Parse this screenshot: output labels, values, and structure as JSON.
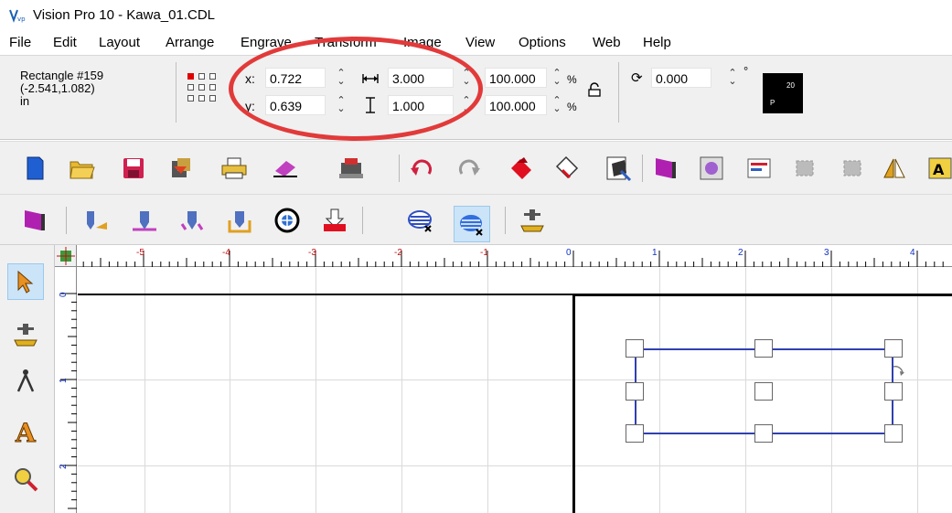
{
  "window": {
    "title": "Vision Pro 10 - Kawa_01.CDL"
  },
  "menu": [
    "File",
    "Edit",
    "Layout",
    "Arrange",
    "Engrave",
    "Transform",
    "Image",
    "View",
    "Options",
    "Web",
    "Help"
  ],
  "object_info": {
    "name": "Rectangle #159",
    "coords": "(-2.541,1.082)",
    "units": "in"
  },
  "properties": {
    "x_label": "x:",
    "x_value": "0.722",
    "y_label": "y:",
    "y_value": "0.639",
    "width_value": "3.000",
    "height_value": "1.000",
    "scale_x": "100.000",
    "scale_y": "100.000",
    "percent": "%",
    "rotation_value": "0.000",
    "degree": "°"
  },
  "font_swatch": {
    "size": "20",
    "label": "P"
  },
  "ruler": {
    "h_labels": [
      "-5",
      "-4",
      "-3",
      "-2",
      "-1",
      "0",
      "1",
      "2",
      "3",
      "4"
    ],
    "v_labels": [
      "0",
      "1",
      "2"
    ]
  },
  "colors": {
    "highlight_ellipse": "#e23a3a",
    "selection": "#3040b0",
    "chrome": "#f0f0f0"
  }
}
